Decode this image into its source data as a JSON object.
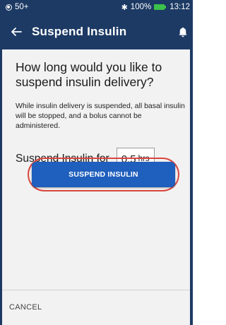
{
  "status_bar": {
    "signal_label": "50+",
    "bluetooth_glyph": "✱",
    "battery_percent": "100%",
    "time": "13:12",
    "battery_color": "#3cc24a"
  },
  "app_bar": {
    "title": "Suspend Insulin",
    "back_icon": "arrow-left-icon",
    "bell_icon": "bell-icon",
    "background_color": "#1c3a64"
  },
  "main": {
    "question": "How long would you like to suspend insulin delivery?",
    "description": "While insulin delivery is suspended, all basal insulin will be stopped, and a bolus cannot be administered.",
    "suspend_label": "Suspend Insulin for",
    "hours_value": "0.5",
    "hours_unit": "hrs",
    "suspend_button_label": "SUSPEND INSULIN",
    "button_color": "#1f5fbd",
    "highlight_color": "#d9463f"
  },
  "footer": {
    "cancel_label": "CANCEL"
  }
}
